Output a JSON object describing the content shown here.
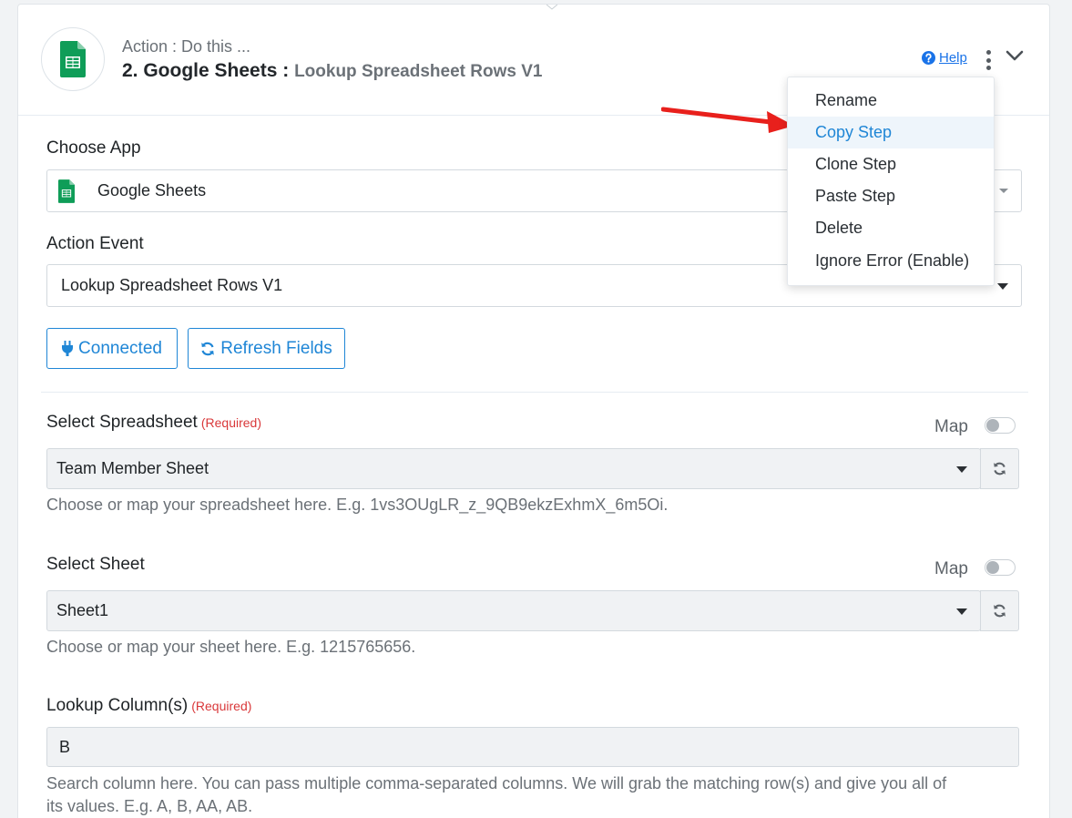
{
  "header": {
    "subtitle": "Action : Do this ...",
    "title_prefix": "2. Google Sheets :",
    "title_event": "Lookup Spreadsheet Rows V1",
    "help_label": "Help"
  },
  "menu": {
    "items": [
      {
        "label": "Rename"
      },
      {
        "label": "Copy Step"
      },
      {
        "label": "Clone Step"
      },
      {
        "label": "Paste Step"
      },
      {
        "label": "Delete"
      },
      {
        "label": "Ignore Error (Enable)"
      }
    ]
  },
  "choose_app": {
    "label": "Choose App",
    "value": "Google Sheets"
  },
  "action_event": {
    "label": "Action Event",
    "value": "Lookup Spreadsheet Rows V1"
  },
  "buttons": {
    "connected": "Connected",
    "refresh_fields": "Refresh Fields"
  },
  "spreadsheet": {
    "label": "Select Spreadsheet",
    "required": "(Required)",
    "map_label": "Map",
    "value": "Team Member Sheet",
    "help": "Choose or map your spreadsheet here. E.g. 1vs3OUgLR_z_9QB9ekzExhmX_6m5Oi."
  },
  "sheet": {
    "label": "Select Sheet",
    "map_label": "Map",
    "value": "Sheet1",
    "help": "Choose or map your sheet here. E.g. 1215765656."
  },
  "lookup_column": {
    "label": "Lookup Column(s)",
    "required": "(Required)",
    "value": "B",
    "help_line1": "Search column here. You can pass multiple comma-separated columns. We will grab the matching row(s) and give you all of",
    "help_line2": "its values. E.g. A, B, AA, AB."
  },
  "colors": {
    "accent": "#1f86d6",
    "required": "#d9383a",
    "sheets_green": "#0f9d58",
    "annotation_arrow": "#e8201c"
  }
}
